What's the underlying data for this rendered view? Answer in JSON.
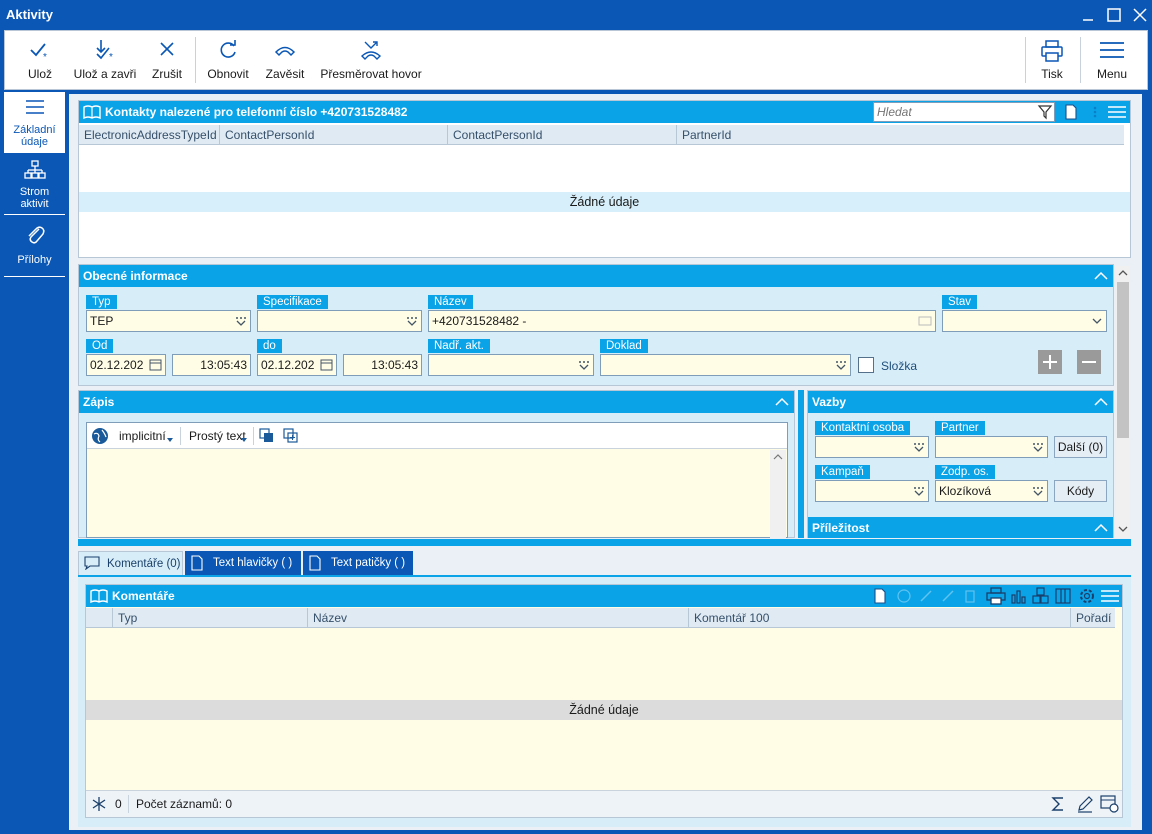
{
  "window": {
    "title": "Aktivity"
  },
  "toolbar": {
    "save": "Ulož",
    "save_close": "Ulož a zavři",
    "cancel": "Zrušit",
    "refresh": "Obnovit",
    "hangup": "Zavěsit",
    "redirect": "Přesměrovat hovor",
    "print": "Tisk",
    "menu": "Menu"
  },
  "nav": {
    "basic_line1": "Základní",
    "basic_line2": "údaje",
    "tree_line1": "Strom",
    "tree_line2": "aktivit",
    "attachments": "Přílohy"
  },
  "contacts": {
    "title": "Kontakty nalezené pro telefonní číslo +420731528482",
    "search_placeholder": "Hledat",
    "columns": [
      "ElectronicAddressTypeId",
      "ContactPersonId",
      "ContactPersonId",
      "PartnerId"
    ],
    "empty": "Žádné údaje"
  },
  "general": {
    "title": "Obecné informace",
    "type_label": "Typ",
    "type_value": "TEP",
    "spec_label": "Specifikace",
    "spec_value": "",
    "name_label": "Název",
    "name_value": "+420731528482 -",
    "state_label": "Stav",
    "state_value": "",
    "from_label": "Od",
    "from_date": "02.12.202",
    "from_time": "13:05:43",
    "to_label": "do",
    "to_date": "02.12.202",
    "to_time": "13:05:43",
    "parent_label": "Nadř. akt.",
    "parent_value": "",
    "doc_label": "Doklad",
    "doc_value": "",
    "folder_label": "Složka"
  },
  "notes": {
    "title": "Zápis",
    "lang": "implicitní",
    "format": "Prostý text"
  },
  "links": {
    "title": "Vazby",
    "contact_label": "Kontaktní osoba",
    "partner_label": "Partner",
    "more_button": "Další (0)",
    "campaign_label": "Kampaň",
    "resp_label": "Zodp. os.",
    "resp_value": "Klozíková",
    "codes_button": "Kódy"
  },
  "opportunity": {
    "title": "Příležitost"
  },
  "tabs": {
    "comments": "Komentáře (0)",
    "header_text": "Text hlavičky ( )",
    "footer_text": "Text patičky ( )"
  },
  "comments": {
    "title": "Komentáře",
    "columns": [
      "Typ",
      "Název",
      "Komentář 100",
      "Pořadí"
    ],
    "empty": "Žádné údaje",
    "count_zero": "0",
    "records": "Počet záznamů: 0"
  },
  "colors": {
    "brand": "#0a57b5",
    "accent": "#0aa3e8",
    "field_bg": "#fffde6"
  }
}
